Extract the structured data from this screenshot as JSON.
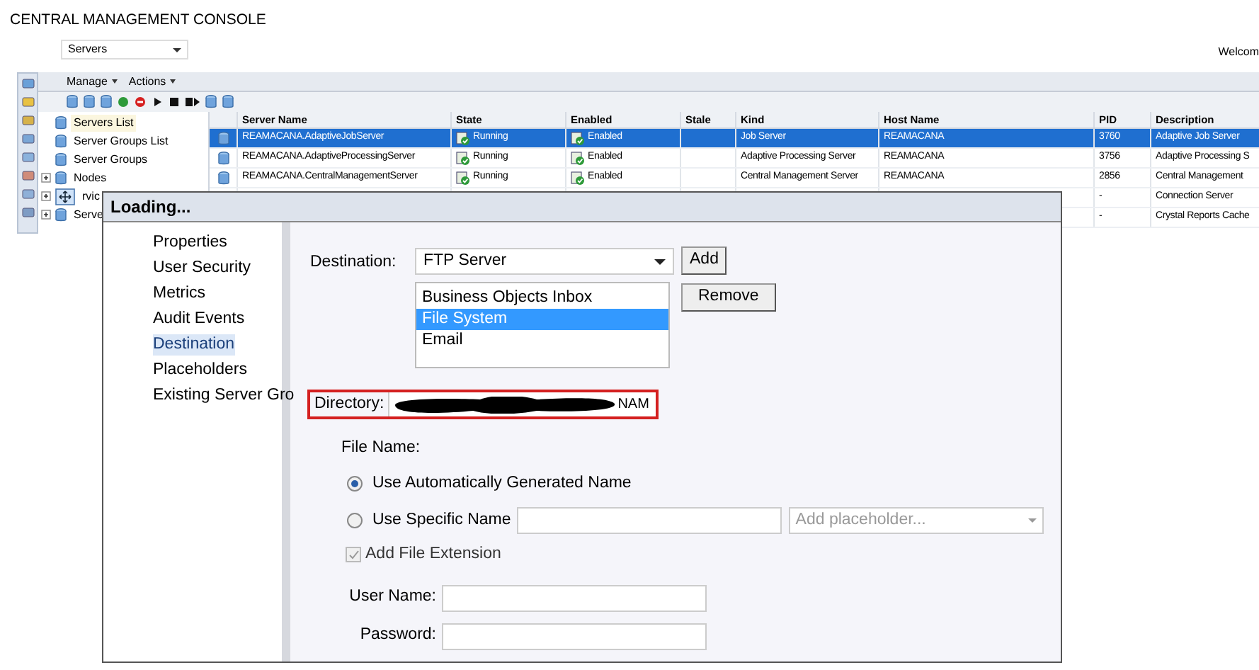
{
  "header": {
    "title": "CENTRAL MANAGEMENT CONSOLE",
    "view_select": "Servers",
    "welcome": "Welcom"
  },
  "menu": [
    "Manage",
    "Actions"
  ],
  "tree": [
    {
      "label": "Servers List",
      "selected": true,
      "expandable": false
    },
    {
      "label": "Server Groups List",
      "selected": false,
      "expandable": false
    },
    {
      "label": "Server Groups",
      "selected": false,
      "expandable": false
    },
    {
      "label": "Nodes",
      "selected": false,
      "expandable": true
    },
    {
      "label": "rvic",
      "selected": false,
      "expandable": true
    },
    {
      "label": "Serve",
      "selected": false,
      "expandable": true
    }
  ],
  "table": {
    "columns": [
      "Server Name",
      "State",
      "Enabled",
      "Stale",
      "Kind",
      "Host Name",
      "PID",
      "Description"
    ],
    "rows": [
      {
        "selected": true,
        "cells": [
          "REAMACANA.AdaptiveJobServer",
          "Running",
          "Enabled",
          null,
          "Job Server",
          "REAMACANA",
          "3760",
          "Adaptive Job Server"
        ]
      },
      {
        "selected": false,
        "cells": [
          "REAMACANA.AdaptiveProcessingServer",
          "Running",
          "Enabled",
          null,
          "Adaptive Processing Server",
          "REAMACANA",
          "3756",
          "Adaptive Processing S"
        ]
      },
      {
        "selected": false,
        "cells": [
          "REAMACANA.CentralManagementServer",
          "Running",
          "Enabled",
          null,
          "Central Management Server",
          "REAMACANA",
          "2856",
          "Central Management"
        ]
      },
      {
        "selected": false,
        "cells": [
          null,
          null,
          null,
          null,
          null,
          null,
          "-",
          "Connection Server"
        ]
      },
      {
        "selected": false,
        "cells": [
          null,
          null,
          null,
          null,
          null,
          null,
          "-",
          "Crystal Reports Cache"
        ]
      }
    ]
  },
  "dialog": {
    "title": "Loading...",
    "nav": [
      {
        "label": "Properties",
        "selected": false
      },
      {
        "label": "User Security",
        "selected": false
      },
      {
        "label": "Metrics",
        "selected": false
      },
      {
        "label": "Audit Events",
        "selected": false
      },
      {
        "label": "Destination",
        "selected": true
      },
      {
        "label": "Placeholders",
        "selected": false
      },
      {
        "label": "Existing Server Gro",
        "selected": false
      }
    ],
    "destination": {
      "label": "Destination:",
      "value": "FTP Server",
      "add": "Add",
      "remove": "Remove",
      "options": [
        {
          "label": "Business Objects Inbox",
          "selected": false
        },
        {
          "label": "File System",
          "selected": true
        },
        {
          "label": "Email",
          "selected": false
        }
      ]
    },
    "directory": {
      "label": "Directory:",
      "value_visible": "NAM",
      "redacted": true
    },
    "file_name": {
      "label": "File Name:",
      "options": [
        {
          "label": "Use Automatically Generated Name",
          "selected": true
        },
        {
          "label": "Use Specific Name",
          "selected": false
        }
      ],
      "placeholder_select": {
        "placeholder": "Add placeholder..."
      },
      "extension": {
        "label": "Add File Extension",
        "checked": true,
        "disabled": true
      }
    },
    "user_name": {
      "label": "User Name:"
    },
    "password": {
      "label": "Password:"
    }
  }
}
